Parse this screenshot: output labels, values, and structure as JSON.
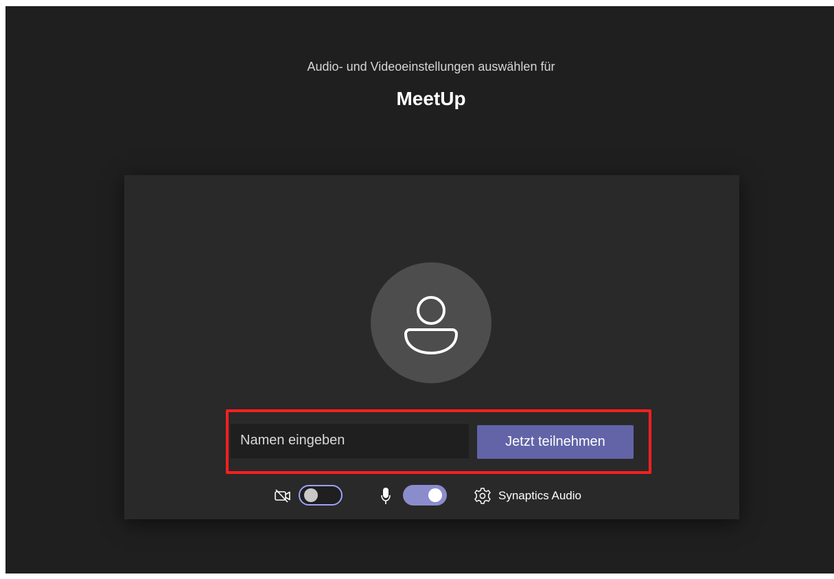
{
  "prejoin": {
    "subtitle": "Audio- und Videoeinstellungen auswählen für",
    "meeting_title": "MeetUp"
  },
  "join_form": {
    "name_placeholder": "Namen eingeben",
    "name_value": "",
    "join_label": "Jetzt teilnehmen"
  },
  "devices": {
    "camera_icon": "camera-off-icon",
    "camera_toggle_on": false,
    "mic_icon": "microphone-icon",
    "mic_toggle_on": true,
    "settings_icon": "gear-icon",
    "audio_device_label": "Synaptics Audio"
  },
  "colors": {
    "background": "#1f1f1f",
    "panel": "#292929",
    "avatar": "#4d4d4d",
    "accent": "#6264a7",
    "toggle_on": "#8b8ccc",
    "toggle_off_border": "#9ea2ff",
    "highlight": "#ff1f1f"
  }
}
